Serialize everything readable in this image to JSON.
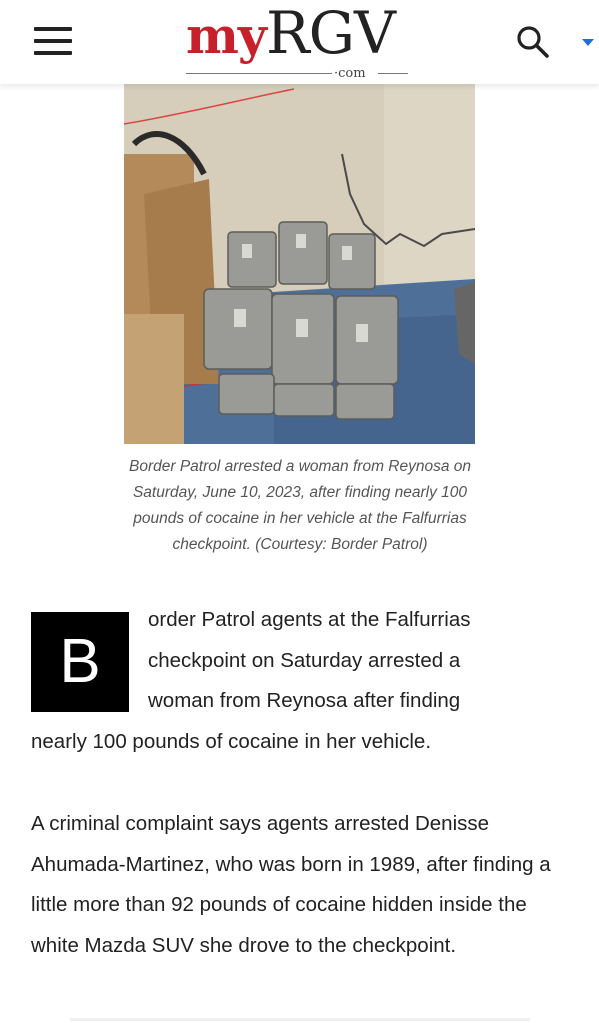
{
  "header": {
    "logo_my": "my",
    "logo_rgv": "RGV",
    "logo_com": "·com",
    "menu_icon": "hamburger-menu-icon",
    "search_icon": "search-icon",
    "dropdown_icon": "caret-down-icon",
    "accent_color": "#c7202a",
    "caret_color": "#1f6fd6"
  },
  "article": {
    "image_alt": "Packages of cocaine stacked on the floor",
    "caption": "Border Patrol arrested a woman from Reynosa on Saturday, June 10, 2023, after finding nearly 100 pounds of cocaine in her vehicle at the Falfurrias checkpoint. (Courtesy: Border Patrol)",
    "dropcap": "B",
    "p1_lines": [
      "order Patrol agents at the Falfurrias",
      "checkpoint on Saturday arrested a",
      "woman from Reynosa after finding"
    ],
    "p1_end": "nearly 100 pounds of cocaine in her vehicle.",
    "p2": "A criminal complaint says agents arrested Denisse Ahumada-Martinez, who was born in 1989, after finding a little more than 92 pounds of cocaine hidden inside the white Mazda SUV she drove to the checkpoint."
  }
}
